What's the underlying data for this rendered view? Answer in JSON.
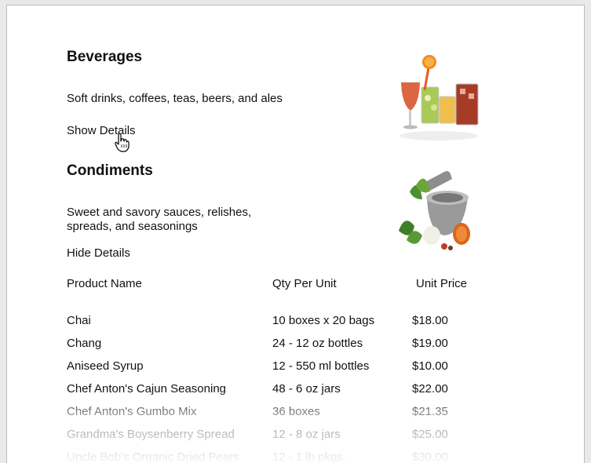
{
  "categories": [
    {
      "title": "Beverages",
      "description": "Soft drinks, coffees, teas, beers, and ales",
      "toggle_label": "Show Details",
      "image_icon": "drinks-image"
    },
    {
      "title": "Condiments",
      "description": "Sweet and savory sauces, relishes, spreads, and seasonings",
      "toggle_label": "Hide Details",
      "image_icon": "mortar-pestle-image"
    }
  ],
  "table": {
    "headers": [
      "Product Name",
      "Qty Per Unit",
      "Unit Price"
    ],
    "rows": [
      [
        "Chai",
        "10 boxes x 20 bags",
        "$18.00"
      ],
      [
        "Chang",
        "24 - 12 oz bottles",
        "$19.00"
      ],
      [
        "Aniseed Syrup",
        "12 - 550 ml bottles",
        "$10.00"
      ],
      [
        "Chef Anton's Cajun Seasoning",
        "48 - 6 oz jars",
        "$22.00"
      ],
      [
        "Chef Anton's Gumbo Mix",
        "36 boxes",
        "$21.35"
      ],
      [
        "Grandma's Boysenberry Spread",
        "12 - 8 oz jars",
        "$25.00"
      ],
      [
        "Uncle Bob's Organic Dried Pears",
        "12 - 1 lb pkgs.",
        "$30.00"
      ]
    ]
  }
}
